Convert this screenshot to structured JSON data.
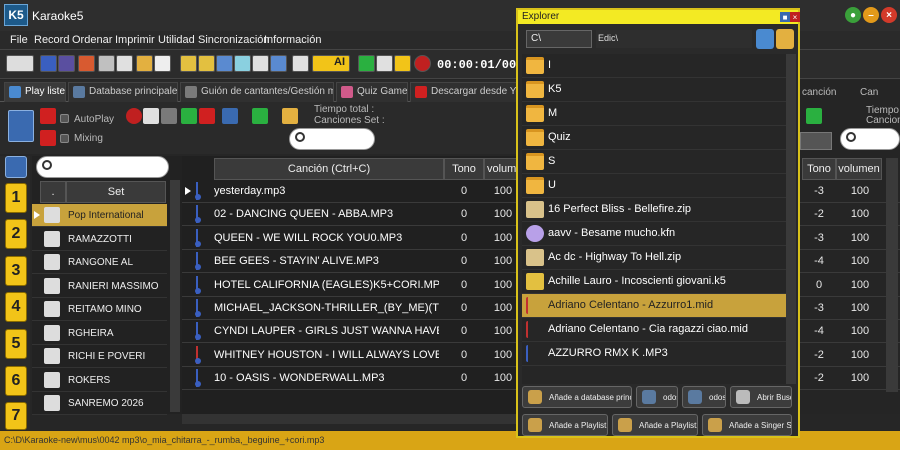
{
  "app": {
    "title": "Karaoke5",
    "logo": "K5"
  },
  "menu": [
    "File",
    "Record",
    "Ordenar",
    "Imprimir",
    "Utilidad",
    "Sincronización",
    "Información"
  ],
  "toolbar": {
    "timer": "00:00:01/00:03",
    "ai_label": "AI"
  },
  "tabs": [
    "Play liste",
    "Database principales",
    "Guión de cantantes/Gestión móvil",
    "Quiz Game",
    "Descargar desde Youtub"
  ],
  "controls": {
    "autoplay": "AutoPlay",
    "mixing": "Mixing",
    "tiempo_total": "Tiempo total :",
    "canciones_set": "Canciones Set :"
  },
  "numbers": [
    "1",
    "2",
    "3",
    "4",
    "5",
    "6",
    "7"
  ],
  "set_panel": {
    "col_dot": ".",
    "col_set": "Set",
    "items": [
      "Pop International",
      "RAMAZZOTTI",
      "RANGONE AL",
      "RANIERI MASSIMO",
      "REITAMO MINO",
      "RGHEIRA",
      "RICHI E POVERI",
      "ROKERS",
      "SANREMO 2026"
    ]
  },
  "song_panel": {
    "col_song": "Canción (Ctrl+C)",
    "col_tono": "Tono",
    "col_vol": "volumen",
    "rows": [
      {
        "name": "yesterday.mp3",
        "tono": "0",
        "vol": "100"
      },
      {
        "name": "02 - DANCING QUEEN - ABBA.MP3",
        "tono": "0",
        "vol": "100"
      },
      {
        "name": "QUEEN - WE WILL ROCK YOU0.MP3",
        "tono": "0",
        "vol": "100"
      },
      {
        "name": "BEE GEES - STAYIN' ALIVE.MP3",
        "tono": "0",
        "vol": "100"
      },
      {
        "name": "HOTEL CALIFORNIA (EAGLES)K5+CORI.MP3",
        "tono": "0",
        "vol": "100"
      },
      {
        "name": "MICHAEL_JACKSON-THRILLER_(BY_ME)(T).MP",
        "tono": "0",
        "vol": "100"
      },
      {
        "name": "CYNDI LAUPER - GIRLS JUST WANNA HAVE FU",
        "tono": "0",
        "vol": "100"
      },
      {
        "name": "WHITNEY HOUSTON - I WILL ALWAYS LOVE YOU",
        "tono": "0",
        "vol": "100"
      },
      {
        "name": "10 - OASIS - WONDERWALL.MP3",
        "tono": "0",
        "vol": "100"
      }
    ]
  },
  "right_panel": {
    "tab_fragment": "canción",
    "tab_fragment2": "Can",
    "tiempo_fragment": "Tiempo",
    "canciones_fragment": "Cancion",
    "col_tono": "Tono",
    "col_vol": "volumen",
    "rows": [
      {
        "tono": "-3",
        "vol": "100"
      },
      {
        "tono": "-2",
        "vol": "100"
      },
      {
        "tono": "-3",
        "vol": "100"
      },
      {
        "tono": "-4",
        "vol": "100"
      },
      {
        "tono": "0",
        "vol": "100"
      },
      {
        "tono": "-3",
        "vol": "100"
      },
      {
        "tono": "-4",
        "vol": "100"
      },
      {
        "tono": "-2",
        "vol": "100"
      },
      {
        "tono": "-2",
        "vol": "100"
      }
    ]
  },
  "status": "C:\\D\\Karaoke-new\\mus\\0042 mp3\\o_mia_chitarra_-_rumba,_beguine_+cori.mp3",
  "explorer": {
    "title": "Explorer",
    "drive": "C\\",
    "path": "Edic\\",
    "items": [
      {
        "type": "folder",
        "name": "I"
      },
      {
        "type": "folder",
        "name": "K5"
      },
      {
        "type": "folder",
        "name": "M"
      },
      {
        "type": "folder",
        "name": "Quiz"
      },
      {
        "type": "folder",
        "name": "S"
      },
      {
        "type": "folder",
        "name": "U"
      },
      {
        "type": "zip",
        "name": "16 Perfect Bliss - Bellefire.zip"
      },
      {
        "type": "kfn",
        "name": "aavv - Besame mucho.kfn"
      },
      {
        "type": "zip",
        "name": "Ac dc - Highway To Hell.zip"
      },
      {
        "type": "k5",
        "name": "Achille Lauro - Incoscienti giovani.k5"
      },
      {
        "type": "mid",
        "name": "Adriano Celentano - Azzurro1.mid"
      },
      {
        "type": "mid",
        "name": "Adriano Celentano - Cia ragazzi ciao.mid"
      },
      {
        "type": "mp3",
        "name": "AZZURRO RMX  K .MP3"
      }
    ],
    "buttons": [
      "Añade a database principales",
      "odos o",
      "odos O",
      "Abrir Busqued",
      "Añade a Playlist1",
      "Añade a Playlist2",
      "Añade a Singer Schedul"
    ]
  }
}
